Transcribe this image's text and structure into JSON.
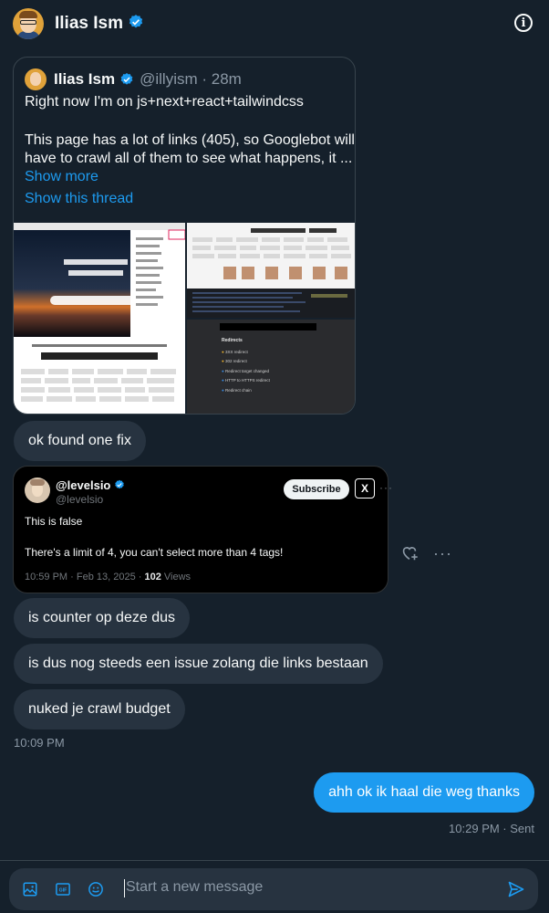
{
  "header": {
    "name": "Ilias Ism",
    "info_icon": "info-icon"
  },
  "quoted_tweet": {
    "author": "Ilias Ism",
    "handle": "@illyism · 28m",
    "line1": "Right now I'm on js+next+react+tailwindcss",
    "line2": "This page has a lot of links (405), so Googlebot will",
    "line3": "have to crawl all of them to see what happens, it ...",
    "show_more": "Show more",
    "show_thread": "Show this thread",
    "media_right_bottom_items": [
      "Redirects",
      "3XX redirect",
      "302 redirect",
      "Redirect target changed",
      "HTTP to HTTPS redirect",
      "Redirect chain"
    ]
  },
  "messages": {
    "m1": "ok found one fix",
    "m2": "is counter op deze dus",
    "m3": "is dus nog steeds een issue zolang die links bestaan",
    "m4": "nuked je crawl budget",
    "time1": "10:09 PM",
    "m5": "ahh ok ik haal die weg thanks",
    "time2": "10:29 PM · Sent"
  },
  "shared_post": {
    "name": "@levelsio",
    "handle": "@levelsio",
    "subscribe": "Subscribe",
    "xlogo": "X",
    "more": "···",
    "text1": "This is false",
    "text2": "There's a limit of 4, you can't select more than 4 tags!",
    "meta_time": "10:59 PM · Feb 13, 2025 · ",
    "meta_views": "102",
    "meta_views_label": " Views"
  },
  "actions": {
    "more": "···"
  },
  "composer": {
    "placeholder": "Start a new message"
  },
  "colors": {
    "background": "#15202b",
    "bubble": "#273340",
    "accent": "#1d9bf0"
  }
}
